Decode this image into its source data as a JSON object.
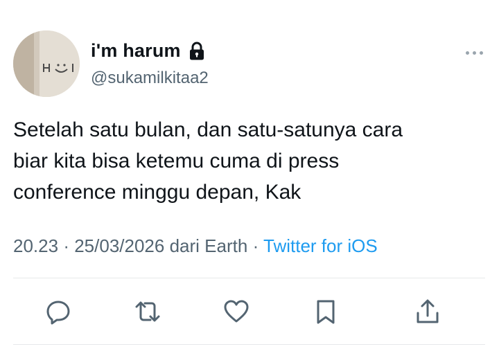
{
  "tweet": {
    "author": {
      "display_name": "i'm harum",
      "handle": "@sukamilkitaa2",
      "protected_icon": "lock-icon"
    },
    "text_lines": [
      "Setelah satu bulan, dan satu-satunya cara",
      "biar kita bisa ketemu cuma di press",
      "conference minggu depan, Kak"
    ],
    "time": "20.23",
    "date": "25/03/2026",
    "separator": "·",
    "location": "dari Earth",
    "source": "Twitter for iOS"
  },
  "actions": [
    {
      "icon": "reply-icon"
    },
    {
      "icon": "retweet-icon"
    },
    {
      "icon": "like-icon"
    },
    {
      "icon": "bookmark-icon"
    },
    {
      "icon": "share-icon"
    }
  ],
  "colors": {
    "text": "#0f1419",
    "secondary": "#536471",
    "link": "#1d9bf0",
    "divider": "#e6e8ea"
  }
}
